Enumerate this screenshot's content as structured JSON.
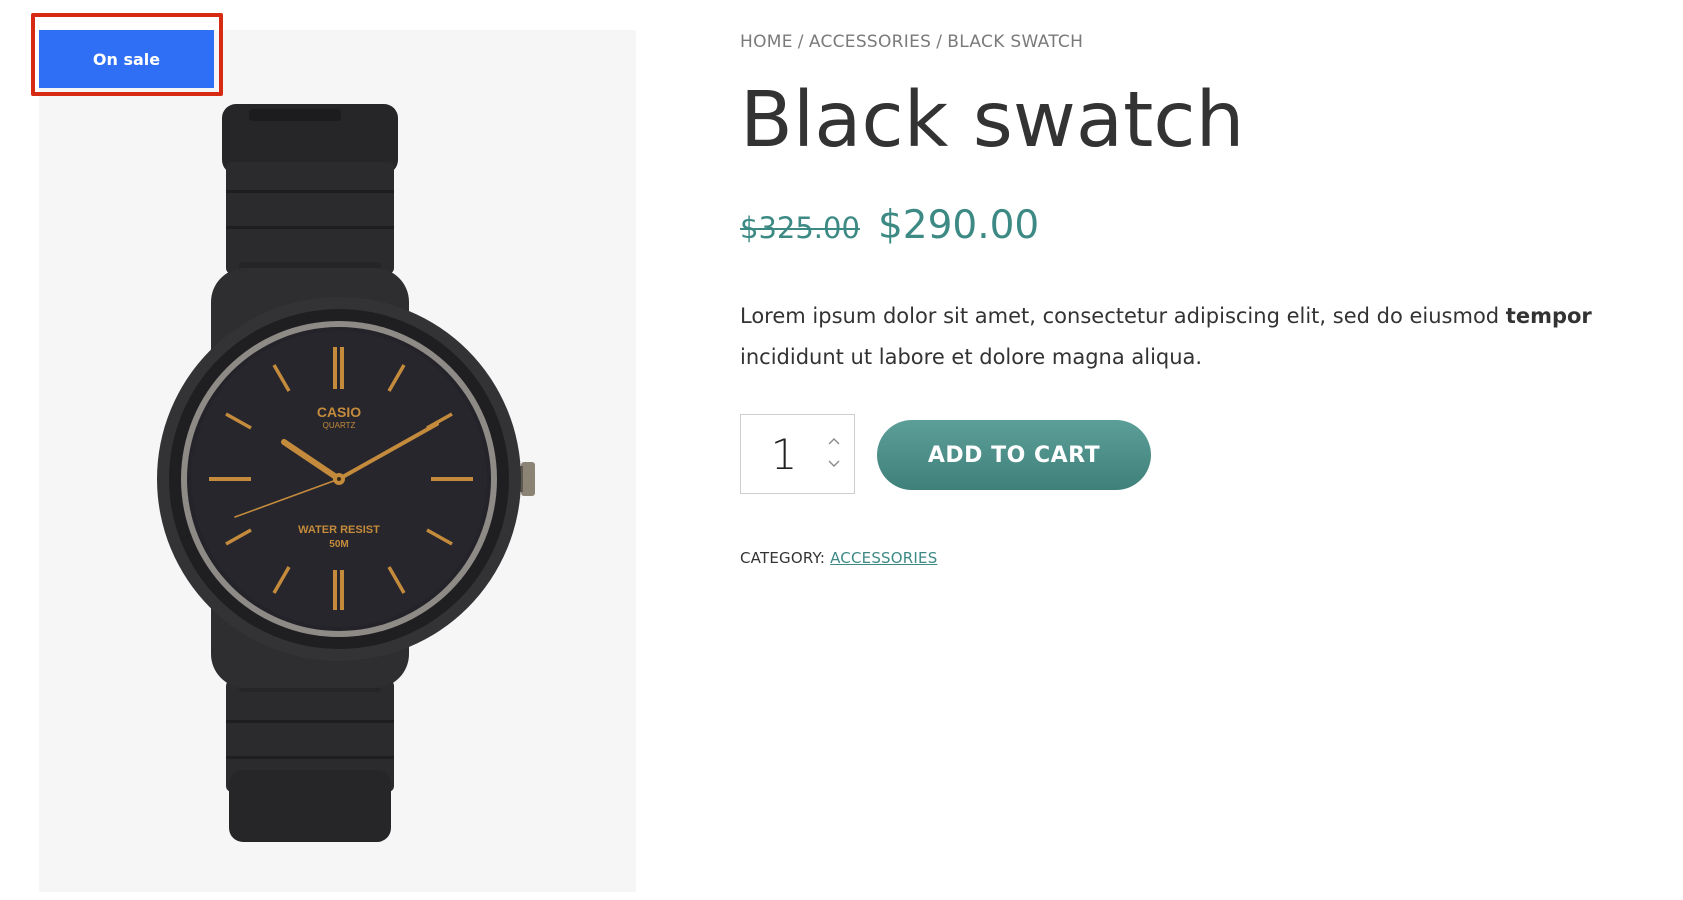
{
  "badge": {
    "sale_label": "On sale",
    "color": "#2f6ff5",
    "highlight_color": "#d62a12"
  },
  "breadcrumb": {
    "items": [
      "HOME",
      "ACCESSORIES",
      "BLACK SWATCH"
    ],
    "separator": "/"
  },
  "product": {
    "title": "Black swatch",
    "image_icon": "wristwatch-image",
    "watch_text": {
      "brand": "CASIO",
      "movement": "QUARTZ",
      "resist": "WATER RESIST",
      "depth": "50M"
    },
    "price_old": "$325.00",
    "price_new": "$290.00",
    "price_color": "#3d8a85",
    "description_part1": "Lorem ipsum dolor sit amet, consectetur adipiscing elit, sed do eiusmod ",
    "description_bold": "tempor",
    "description_part2": "incididunt ut labore et dolore magna aliqua."
  },
  "cart": {
    "quantity": "1",
    "stepper_up_icon": "chevron-up-icon",
    "stepper_down_icon": "chevron-down-icon",
    "add_to_cart_label": "ADD TO CART",
    "button_color": "#4f928c"
  },
  "meta": {
    "category_label": "CATEGORY:",
    "category_value": "ACCESSORIES"
  }
}
